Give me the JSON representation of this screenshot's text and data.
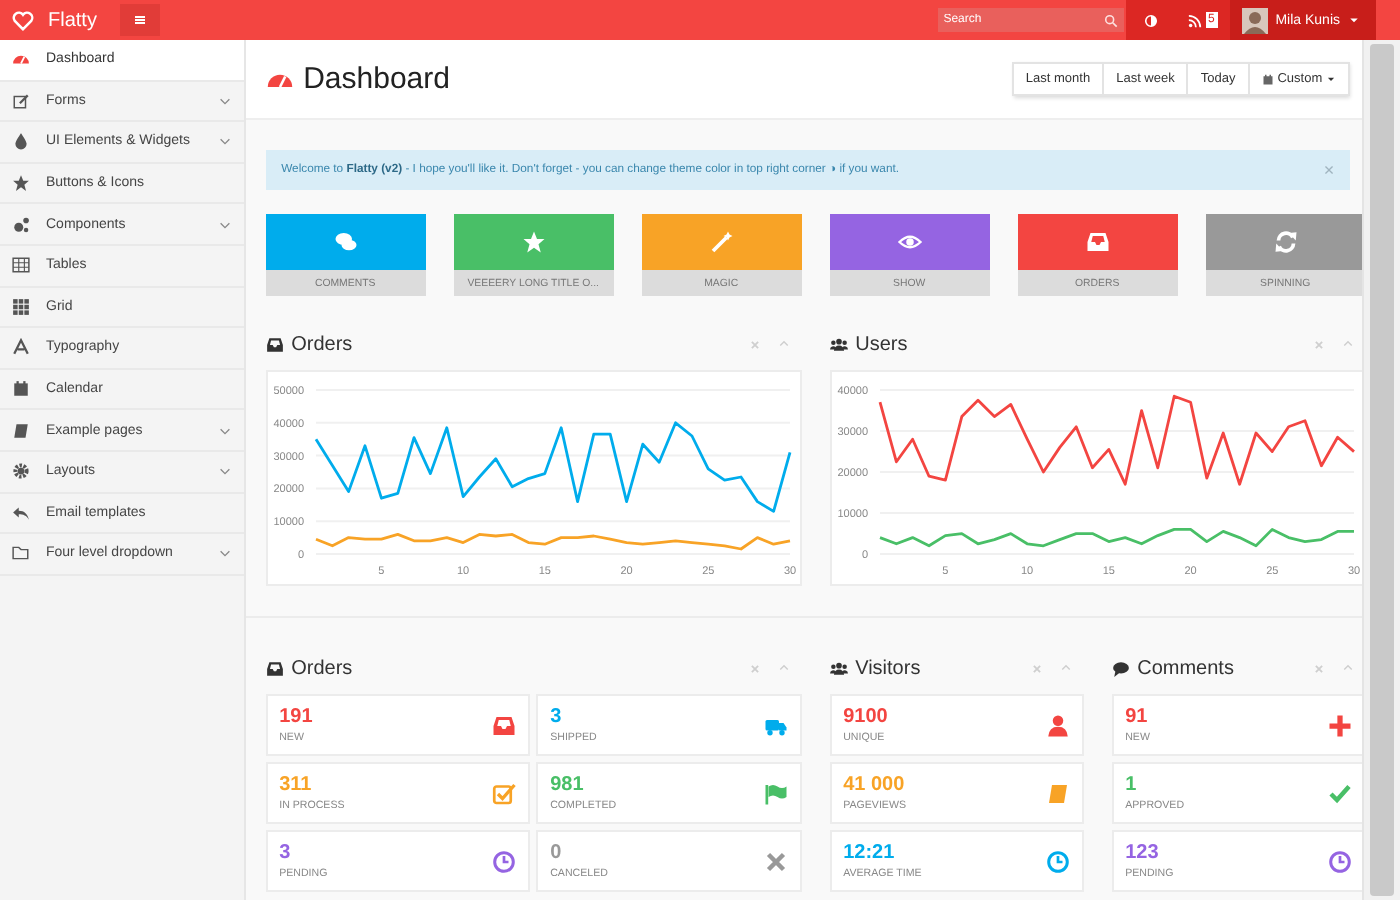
{
  "header": {
    "logo": "Flatty",
    "search": {
      "placeholder": "Search"
    },
    "notification_badge": "5",
    "user": {
      "name": "Mila Kunis"
    }
  },
  "sidebar": {
    "items": [
      {
        "label": "Dashboard",
        "selected": true,
        "submenu": false
      },
      {
        "label": "Forms",
        "selected": false,
        "submenu": true
      },
      {
        "label": "UI Elements & Widgets",
        "selected": false,
        "submenu": true
      },
      {
        "label": "Buttons & Icons",
        "selected": false,
        "submenu": false
      },
      {
        "label": "Components",
        "selected": false,
        "submenu": true
      },
      {
        "label": "Tables",
        "selected": false,
        "submenu": false
      },
      {
        "label": "Grid",
        "selected": false,
        "submenu": false
      },
      {
        "label": "Typography",
        "selected": false,
        "submenu": false
      },
      {
        "label": "Calendar",
        "selected": false,
        "submenu": false
      },
      {
        "label": "Example pages",
        "selected": false,
        "submenu": true
      },
      {
        "label": "Layouts",
        "selected": false,
        "submenu": true
      },
      {
        "label": "Email templates",
        "selected": false,
        "submenu": false
      },
      {
        "label": "Four level dropdown",
        "selected": false,
        "submenu": true
      }
    ]
  },
  "page_title": "Dashboard",
  "date_filters": [
    "Last month",
    "Last week",
    "Today",
    "Custom"
  ],
  "alert": {
    "text": "Welcome to **Flatty (v2)** - I hope you'll like it. Don't forget - you can change theme color in top right corner ◑ if you want.",
    "close": "×"
  },
  "tiles": [
    {
      "label": "COMMENTS",
      "color": "#00acec"
    },
    {
      "label": "VEEEERY LONG TITLE O...",
      "color": "#49bf67"
    },
    {
      "label": "MAGIC",
      "color": "#f8a326"
    },
    {
      "label": "SHOW",
      "color": "#9564e2"
    },
    {
      "label": "ORDERS",
      "color": "#f34541"
    },
    {
      "label": "SPINNING",
      "color": "#999999"
    }
  ],
  "chart_widgets": [
    {
      "title": "Orders",
      "chart_data": {
        "type": "line",
        "grid": true,
        "x": [
          1,
          2,
          3,
          4,
          5,
          6,
          7,
          8,
          9,
          10,
          11,
          12,
          13,
          14,
          15,
          16,
          17,
          18,
          19,
          20,
          21,
          22,
          23,
          24,
          25,
          26,
          27,
          28,
          29,
          30
        ],
        "xlim": [
          1,
          30
        ],
        "ylim": [
          0,
          50000
        ],
        "xticks": [
          5,
          10,
          15,
          20,
          25,
          30
        ],
        "yticks": [
          0,
          10000,
          20000,
          30000,
          40000,
          50000
        ],
        "series": [
          {
            "color": "#00acec",
            "values": [
              35000,
              27000,
              19000,
              33000,
              17000,
              18500,
              35500,
              24500,
              38500,
              17500,
              23500,
              29000,
              20500,
              23000,
              24500,
              38500,
              16000,
              36500,
              36500,
              16000,
              33500,
              28000,
              40000,
              36000,
              26000,
              22500,
              23500,
              16000,
              13000,
              31000
            ]
          },
          {
            "color": "#f8a326",
            "values": [
              4500,
              2500,
              5000,
              4500,
              4500,
              6000,
              4000,
              4000,
              5000,
              3500,
              6000,
              5500,
              6000,
              3500,
              3000,
              5000,
              5000,
              5500,
              4500,
              3500,
              3000,
              3500,
              4000,
              3500,
              3000,
              2500,
              1500,
              5000,
              3000,
              4000
            ]
          }
        ]
      }
    },
    {
      "title": "Users",
      "chart_data": {
        "type": "line",
        "grid": true,
        "x": [
          1,
          2,
          3,
          4,
          5,
          6,
          7,
          8,
          9,
          10,
          11,
          12,
          13,
          14,
          15,
          16,
          17,
          18,
          19,
          20,
          21,
          22,
          23,
          24,
          25,
          26,
          27,
          28,
          29,
          30
        ],
        "xlim": [
          1,
          30
        ],
        "ylim": [
          0,
          40000
        ],
        "xticks": [
          5,
          10,
          15,
          20,
          25,
          30
        ],
        "yticks": [
          0,
          10000,
          20000,
          30000,
          40000
        ],
        "series": [
          {
            "color": "#f34541",
            "values": [
              37000,
              22500,
              28000,
              19000,
              18000,
              33500,
              37500,
              33500,
              36500,
              28000,
              20000,
              26000,
              31000,
              21000,
              25500,
              17000,
              35000,
              21000,
              38500,
              37000,
              18500,
              29500,
              17000,
              29500,
              25000,
              31000,
              32500,
              21500,
              28500,
              25000
            ]
          },
          {
            "color": "#49bf67",
            "values": [
              4000,
              2500,
              4000,
              2000,
              4500,
              5000,
              2500,
              3500,
              5000,
              2500,
              2000,
              3500,
              5000,
              5000,
              3000,
              4000,
              2500,
              4500,
              6000,
              6000,
              3000,
              5500,
              4000,
              2000,
              6000,
              4000,
              3000,
              3500,
              5500,
              5500
            ]
          }
        ]
      }
    }
  ],
  "stat_widgets": [
    {
      "title": "Orders",
      "items": [
        {
          "value": "191",
          "label": "NEW",
          "color": "#f34541"
        },
        {
          "value": "3",
          "label": "SHIPPED",
          "color": "#00acec"
        },
        {
          "value": "311",
          "label": "IN PROCESS",
          "color": "#f8a326"
        },
        {
          "value": "981",
          "label": "COMPLETED",
          "color": "#49bf67"
        },
        {
          "value": "3",
          "label": "PENDING",
          "color": "#9564e2"
        },
        {
          "value": "0",
          "label": "CANCELED",
          "color": "#999999"
        }
      ]
    },
    {
      "title": "Visitors",
      "items": [
        {
          "value": "9100",
          "label": "UNIQUE",
          "color": "#f34541"
        },
        {
          "value": "41 000",
          "label": "PAGEVIEWS",
          "color": "#f8a326"
        },
        {
          "value": "12:21",
          "label": "AVERAGE TIME",
          "color": "#00acec"
        }
      ]
    },
    {
      "title": "Comments",
      "items": [
        {
          "value": "91",
          "label": "NEW",
          "color": "#f34541"
        },
        {
          "value": "1",
          "label": "APPROVED",
          "color": "#49bf67"
        },
        {
          "value": "123",
          "label": "PENDING",
          "color": "#9564e2"
        }
      ]
    }
  ]
}
